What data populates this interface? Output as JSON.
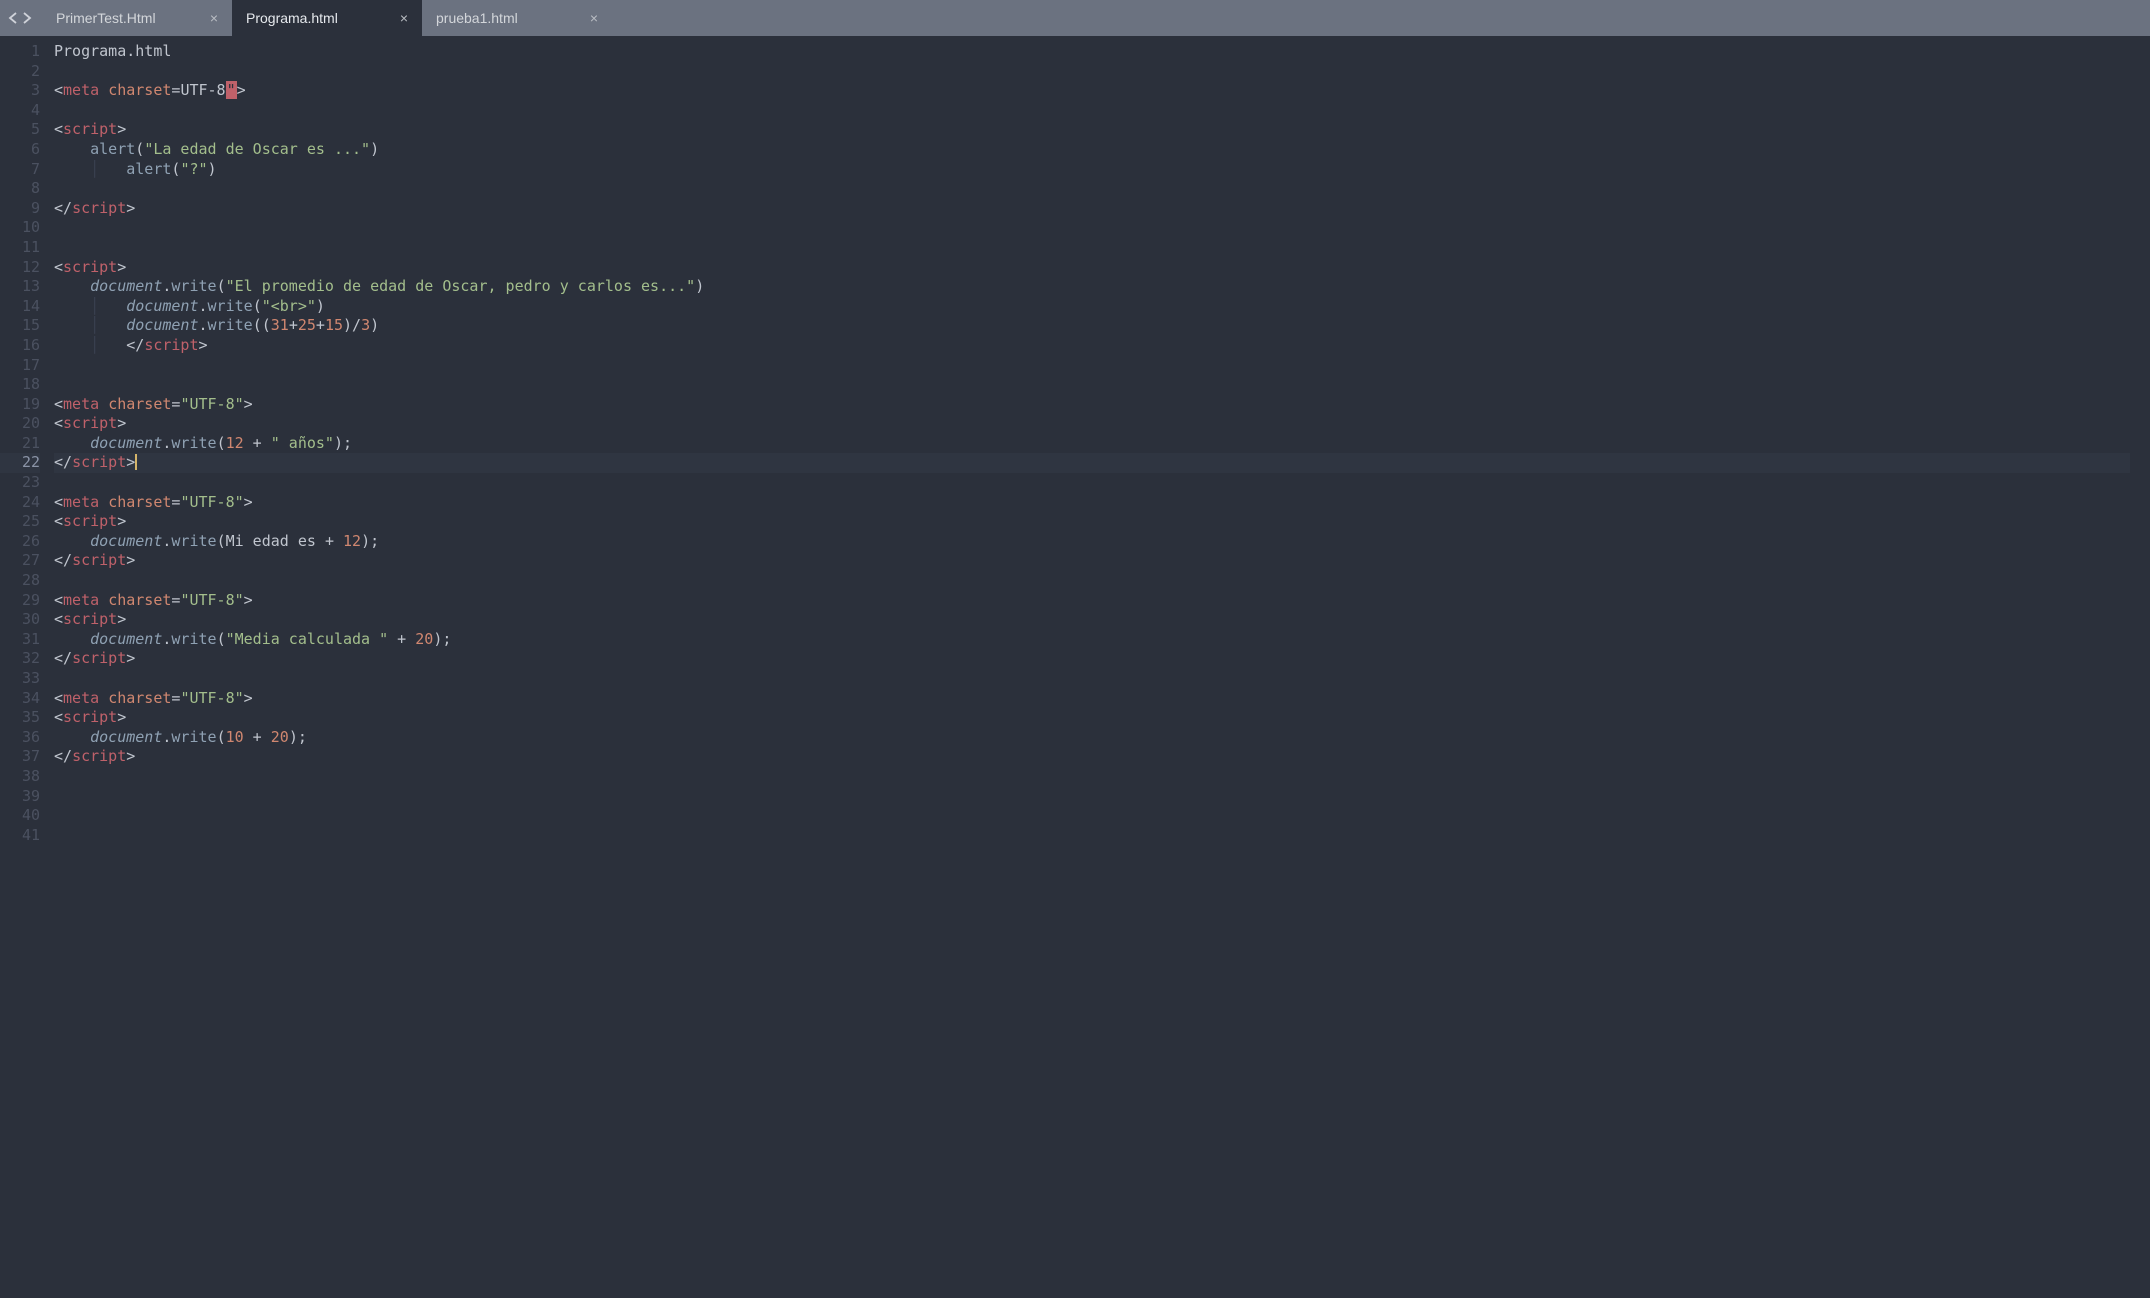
{
  "tabs": [
    {
      "label": "PrimerTest.Html",
      "active": false
    },
    {
      "label": "Programa.html",
      "active": true
    },
    {
      "label": "prueba1.html",
      "active": false
    }
  ],
  "editor": {
    "current_line": 22,
    "line_count": 41
  },
  "code": {
    "l1_text": "Programa.html",
    "l3_attr": "charset",
    "l3_val": "UTF-8",
    "l3_errq": "\"",
    "l5_tag_open": "script",
    "l6_fn": "alert",
    "l6_str": "\"La edad de Oscar es ...\"",
    "l7_fn": "alert",
    "l7_str": "\"?\"",
    "l9_tag_close": "script",
    "l12_tag_open": "script",
    "l13_obj": "document",
    "l13_fn": "write",
    "l13_str": "\"El promedio de edad de Oscar, pedro y carlos es...\"",
    "l14_obj": "document",
    "l14_fn": "write",
    "l14_str": "\"<br>\"",
    "l15_obj": "document",
    "l15_fn": "write",
    "l15_n1": "31",
    "l15_n2": "25",
    "l15_n3": "15",
    "l15_div": "3",
    "l16_tag_close": "script",
    "l19_attr": "charset",
    "l19_val": "\"UTF-8\"",
    "l20_tag_open": "script",
    "l21_obj": "document",
    "l21_fn": "write",
    "l21_n": "12",
    "l21_str": "\" años\"",
    "l22_tag_close": "script",
    "l24_attr": "charset",
    "l24_val": "\"UTF-8\"",
    "l25_tag_open": "script",
    "l26_obj": "document",
    "l26_fn": "write",
    "l26_txt": "Mi edad es ",
    "l26_n": "12",
    "l27_tag_close": "script",
    "l29_attr": "charset",
    "l29_val": "\"UTF-8\"",
    "l30_tag_open": "script",
    "l31_obj": "document",
    "l31_fn": "write",
    "l31_str": "\"Media calculada \"",
    "l31_n": "20",
    "l32_tag_close": "script",
    "l34_attr": "charset",
    "l34_val": "\"UTF-8\"",
    "l35_tag_open": "script",
    "l36_obj": "document",
    "l36_fn": "write",
    "l36_n1": "10",
    "l36_n2": "20",
    "l37_tag_close": "script",
    "tag_meta": "meta",
    "tag_script": "script"
  }
}
